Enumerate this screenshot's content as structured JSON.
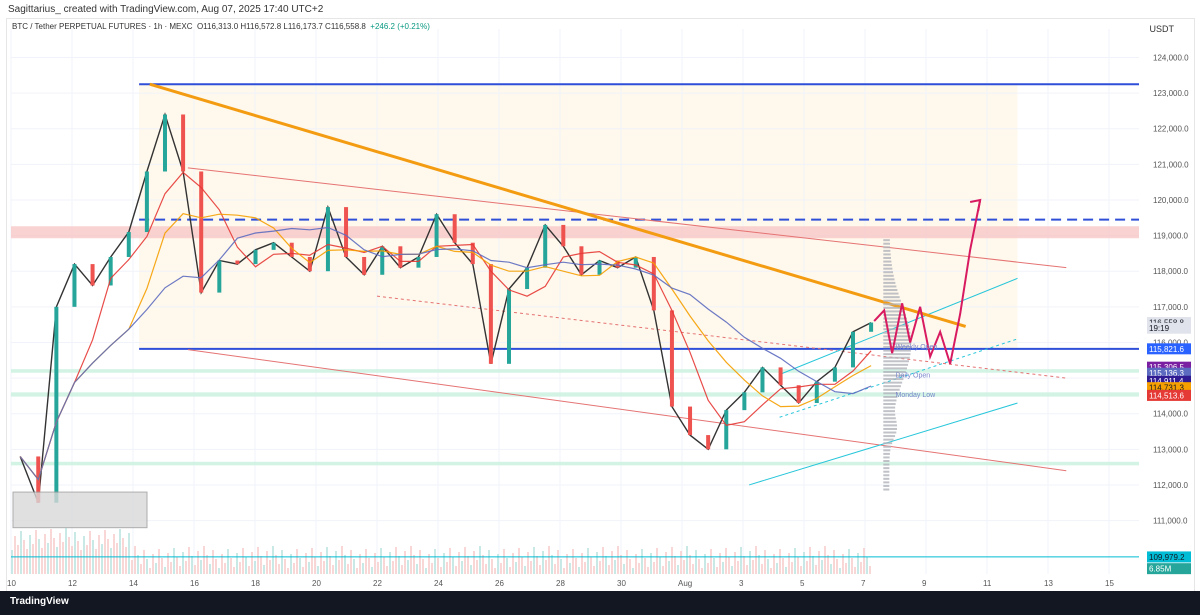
{
  "header": {
    "credit": "Sagittarius_ created with TradingView.com, Aug 07, 2025 17:40 UTC+2",
    "symbol": "BTC / Tether PERPETUAL FUTURES · 1h · MEXC",
    "ohlc": "O116,313.0 H116,572.8 L116,173.7 C116,558.8",
    "change": "+246.2 (+0.21%)",
    "currency": "USDT"
  },
  "footer": {
    "brand": "TradingView"
  },
  "chart_data": {
    "type": "line",
    "x_ticks": [
      "10",
      "12",
      "14",
      "16",
      "18",
      "20",
      "22",
      "24",
      "26",
      "28",
      "30",
      "Aug",
      "3",
      "5",
      "7",
      "9",
      "11",
      "13",
      "15"
    ],
    "y_ticks": [
      "124,000.0",
      "123,000.0",
      "122,000.0",
      "121,000.0",
      "120,000.0",
      "119,000.0",
      "118,000.0",
      "117,000.0",
      "116,000.0",
      "115,000.0",
      "114,000.0",
      "113,000.0",
      "112,000.0",
      "111,000.0"
    ],
    "y_lim": [
      109500,
      124800
    ],
    "price_labels": [
      {
        "text": "116,558.8",
        "value": 116558.8,
        "bg": "#e0e3eb",
        "fg": "#131722"
      },
      {
        "text": "19:19",
        "value": 116400,
        "bg": "#e0e3eb",
        "fg": "#131722"
      },
      {
        "text": "115,821.6",
        "value": 115821.6,
        "bg": "#2962ff",
        "fg": "#ffffff"
      },
      {
        "text": "115,306.5",
        "value": 115306.5,
        "bg": "#7b1fa2",
        "fg": "#ffffff"
      },
      {
        "text": "115,136.3",
        "value": 115136.3,
        "bg": "#5c6bc0",
        "fg": "#ffffff"
      },
      {
        "text": "114,911.4",
        "value": 114911.4,
        "bg": "#311b92",
        "fg": "#ffffff"
      },
      {
        "text": "114,731.3",
        "value": 114731.3,
        "bg": "#f59f00",
        "fg": "#131722"
      },
      {
        "text": "114,513.6",
        "value": 114513.6,
        "bg": "#e53935",
        "fg": "#ffffff"
      },
      {
        "text": "109,979.2",
        "value": 109979.2,
        "bg": "#00bcd4",
        "fg": "#131722"
      },
      {
        "text": "6.85M",
        "value": 109650,
        "bg": "#26a69a",
        "fg": "#ffffff"
      }
    ],
    "annotations": [
      {
        "text": "Weekly Open",
        "x": "Aug 8",
        "value": 115900
      },
      {
        "text": "Daily Open",
        "x": "Aug 8",
        "value": 115100
      },
      {
        "text": "Monday Low",
        "x": "Aug 8",
        "value": 114560
      }
    ],
    "levels": [
      {
        "name": "Range high",
        "value": 123250,
        "color": "#2f4fd8"
      },
      {
        "name": "Range mid",
        "value": 119450,
        "color": "#2f4fd8",
        "dashed": true
      },
      {
        "name": "Range low",
        "value": 115821.6,
        "color": "#2f4fd8"
      }
    ],
    "resistance_zone": [
      118950,
      119150
    ],
    "support_zones": [
      [
        115150,
        115250
      ],
      [
        114480,
        114600
      ],
      [
        112550,
        112650
      ]
    ],
    "series": [
      {
        "values": [
          112800,
          111500,
          117000,
          118200,
          117600,
          118400,
          119100,
          120800,
          122400,
          120800,
          117400,
          118300,
          118200,
          118600,
          118800,
          118400,
          118000,
          119800,
          118400,
          117900,
          118700,
          118100,
          118400,
          119600,
          118800,
          118200,
          115400,
          117500,
          118100,
          119300,
          118700,
          117900,
          118300,
          118100,
          118400,
          116900,
          114200,
          113400,
          113000,
          114100,
          114600,
          115300,
          114800,
          114300,
          114900,
          115300,
          116300,
          116558.8
        ],
        "color": "#333333"
      }
    ],
    "x_range": [
      "Jul 10",
      "Aug 7 17:00"
    ],
    "colors": {
      "up": "#26a69a",
      "down": "#ef5350",
      "trendline": "#f39c12",
      "channel": "#e57373",
      "projection": "#d81b60",
      "volume_profile": "#b0b3ba",
      "grid": "#f0f3fa"
    }
  }
}
